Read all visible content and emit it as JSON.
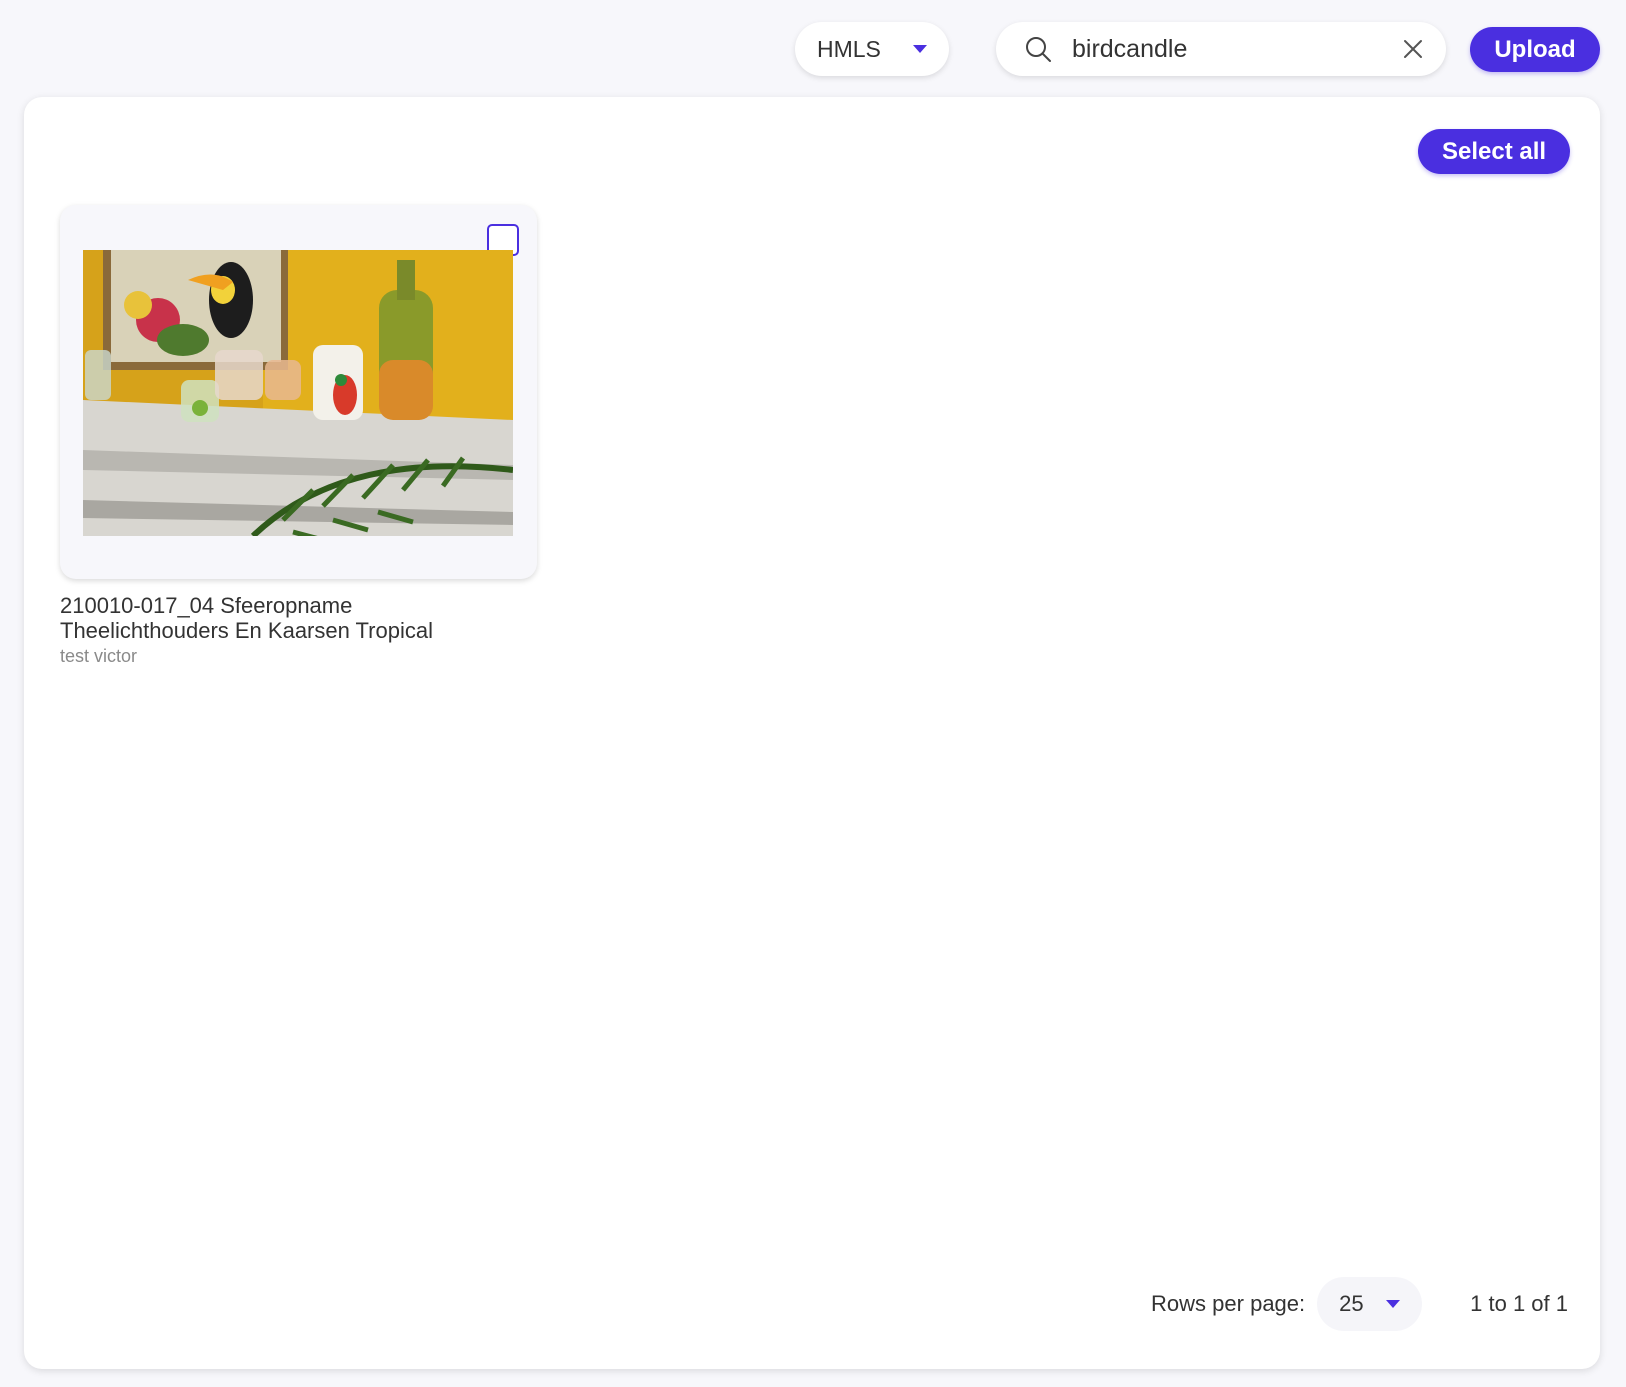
{
  "topbar": {
    "library_select": {
      "value": "HMLS",
      "icon": "chevron-down-icon"
    },
    "search": {
      "value": "birdcandle",
      "icons": [
        "search-icon",
        "close-icon"
      ]
    },
    "upload_label": "Upload"
  },
  "panel": {
    "select_all_label": "Select all",
    "assets": [
      {
        "title": "210010-017_04 Sfeeropname Theelichthouders En Kaarsen Tropical",
        "owner": "test victor",
        "selected": false
      }
    ],
    "pagination": {
      "rows_per_page_label": "Rows per page:",
      "rows_per_page_value": "25",
      "range_text": "1 to 1 of 1"
    }
  },
  "colors": {
    "accent": "#4a2fe0",
    "background": "#f7f7fb",
    "panel": "#ffffff",
    "text": "#333333",
    "muted_text": "#8a8a8a"
  }
}
